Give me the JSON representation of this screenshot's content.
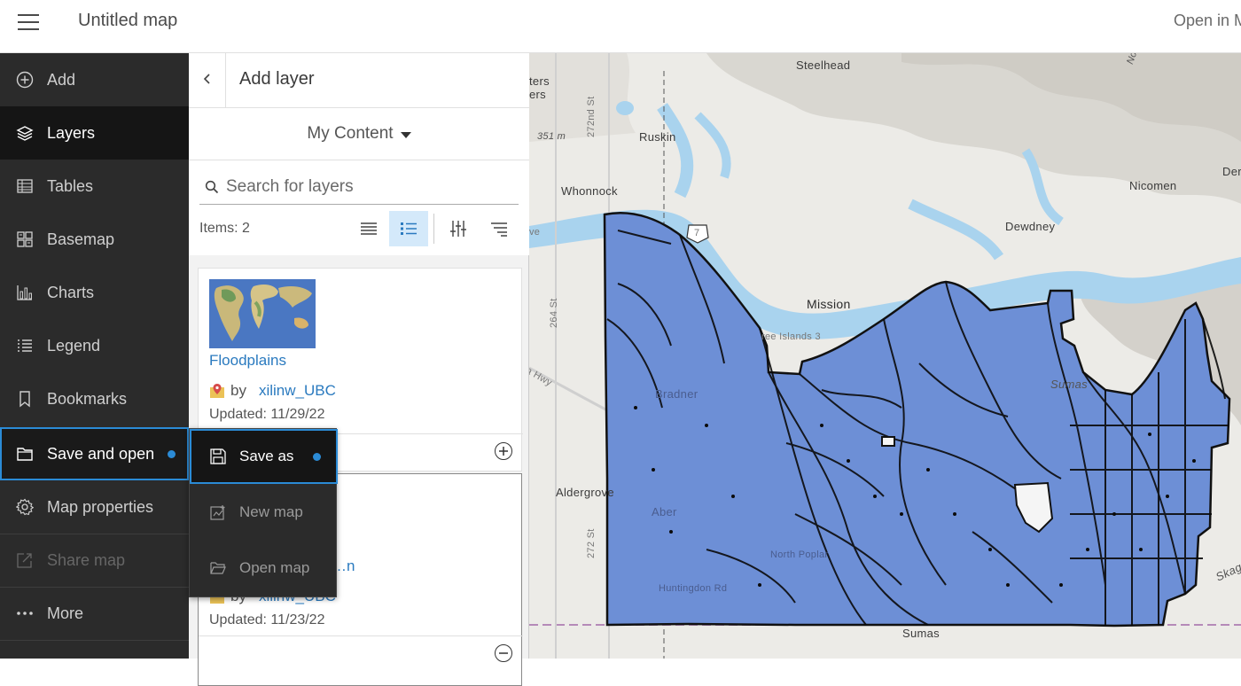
{
  "header": {
    "title": "Untitled map",
    "open_in": "Open in M"
  },
  "nav": {
    "items": [
      {
        "label": "Add",
        "icon": "add-circle-icon"
      },
      {
        "label": "Layers",
        "icon": "layers-icon"
      },
      {
        "label": "Tables",
        "icon": "table-icon"
      },
      {
        "label": "Basemap",
        "icon": "basemap-icon"
      },
      {
        "label": "Charts",
        "icon": "chart-icon"
      },
      {
        "label": "Legend",
        "icon": "legend-icon"
      },
      {
        "label": "Bookmarks",
        "icon": "bookmark-icon"
      },
      {
        "label": "Save and open",
        "icon": "folder-icon"
      },
      {
        "label": "Map properties",
        "icon": "gear-icon"
      },
      {
        "label": "Share map",
        "icon": "share-icon"
      },
      {
        "label": "More",
        "icon": "more-icon"
      }
    ]
  },
  "panel": {
    "title": "Add layer",
    "content_source": "My Content",
    "search_placeholder": "Search for layers",
    "items_count": "Items: 2",
    "cards": [
      {
        "title": "Floodplains",
        "by": "by",
        "owner": "xilinw_UBC",
        "updated": "Updated: 11/29/22"
      },
      {
        "title": "…n",
        "by": "by",
        "owner": "xilinw_UBC",
        "updated": "Updated: 11/23/22"
      }
    ]
  },
  "flyout": {
    "items": [
      {
        "label": "Save as",
        "icon": "save-icon"
      },
      {
        "label": "New map",
        "icon": "new-map-icon"
      },
      {
        "label": "Open map",
        "icon": "open-folder-icon"
      }
    ]
  },
  "map": {
    "labels": {
      "steelhead": "Steelhead",
      "ters": "ters",
      "ers": "ers",
      "elev": "351 m",
      "st272": "272nd St",
      "ruskin": "Ruskin",
      "whonnock": "Whonnock",
      "nicomen": "Nicomen",
      "dero": "Dero",
      "dewdney": "Dewdney",
      "ve": "ve",
      "hwy7": "7",
      "st264": "264 St",
      "mission": "Mission",
      "threeislands": "ree Islands 3",
      "hwy": "a Hwy",
      "sumas_r": "Sumas",
      "bradner": "Bradner",
      "aldergrove": "Aldergrove",
      "st272b": "272 St",
      "aber": "Aber",
      "npoplar": "North Poplar",
      "huntingdon": "Huntingdon Rd",
      "sumas": "Sumas",
      "skag": "Skag",
      "nort": "Nort"
    },
    "colors": {
      "floodplain_fill": "#6d8fd6",
      "river": "#a9d3ee",
      "land": "#ecebe7"
    }
  }
}
